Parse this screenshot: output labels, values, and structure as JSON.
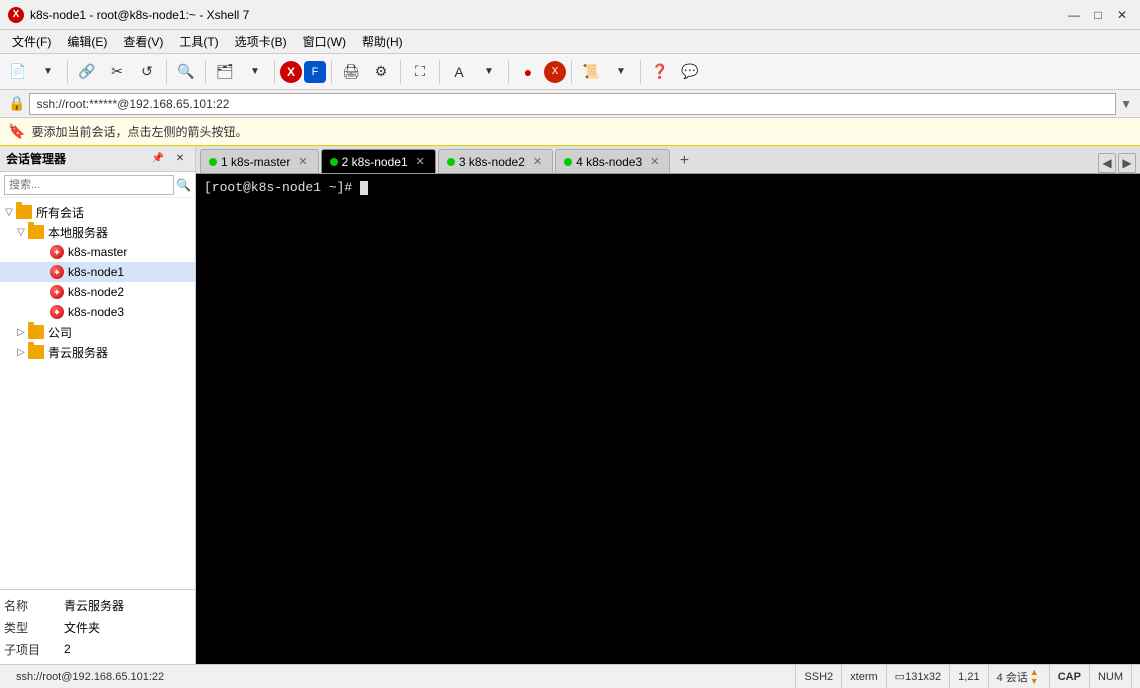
{
  "window": {
    "title": "k8s-node1 - root@k8s-node1:~ - Xshell 7",
    "icon_label": "X"
  },
  "menu": {
    "items": [
      "文件(F)",
      "编辑(E)",
      "查看(V)",
      "工具(T)",
      "选项卡(B)",
      "窗口(W)",
      "帮助(H)"
    ]
  },
  "address_bar": {
    "value": "ssh://root:******@192.168.65.101:22"
  },
  "hint_bar": {
    "text": "要添加当前会话，点击左侧的箭头按钮。"
  },
  "sidebar": {
    "title": "会话管理器",
    "tree": {
      "root": "所有会话",
      "groups": [
        {
          "name": "本地服务器",
          "servers": [
            "k8s-master",
            "k8s-node1",
            "k8s-node2",
            "k8s-node3"
          ]
        },
        {
          "name": "公司",
          "servers": []
        },
        {
          "name": "青云服务器",
          "servers": []
        }
      ]
    }
  },
  "props": {
    "rows": [
      {
        "label": "名称",
        "value": "青云服务器"
      },
      {
        "label": "类型",
        "value": "文件夹"
      },
      {
        "label": "子项目",
        "value": "2"
      }
    ]
  },
  "tabs": [
    {
      "id": 1,
      "label": "1 k8s-master",
      "dot_color": "#00cc00",
      "active": false
    },
    {
      "id": 2,
      "label": "2 k8s-node1",
      "dot_color": "#00cc00",
      "active": true
    },
    {
      "id": 3,
      "label": "3 k8s-node2",
      "dot_color": "#00cc00",
      "active": false
    },
    {
      "id": 4,
      "label": "4 k8s-node3",
      "dot_color": "#00cc00",
      "active": false
    }
  ],
  "terminal": {
    "prompt": "[root@k8s-node1 ~]# "
  },
  "status_bar": {
    "connection": "ssh://root@192.168.65.101:22",
    "protocol": "SSH2",
    "encoding": "xterm",
    "dimensions": "131x32",
    "cursor": "1,21",
    "sessions": "4 会话",
    "cap": "CAP",
    "num": "NUM"
  }
}
